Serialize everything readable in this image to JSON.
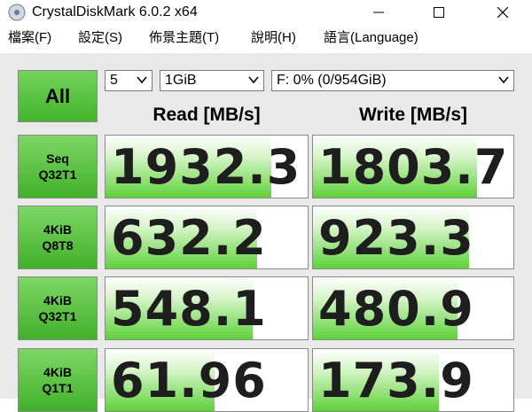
{
  "window": {
    "title": "CrystalDiskMark 6.0.2 x64"
  },
  "menu": [
    {
      "label": "檔案(F)"
    },
    {
      "label": "設定(S)"
    },
    {
      "label": "佈景主題(T)"
    },
    {
      "label": "說明(H)"
    },
    {
      "label": "語言(Language)"
    }
  ],
  "controls": {
    "all_label": "All",
    "test_count": "5",
    "test_size": "1GiB",
    "drive": "F: 0% (0/954GiB)"
  },
  "headers": {
    "read": "Read [MB/s]",
    "write": "Write [MB/s]"
  },
  "tests": [
    {
      "line1": "Seq",
      "line2": "Q32T1",
      "read": "1932.3",
      "write": "1803.7",
      "read_level": 0.82,
      "write_level": 0.82
    },
    {
      "line1": "4KiB",
      "line2": "Q8T8",
      "read": "632.2",
      "write": "923.3",
      "read_level": 0.75,
      "write_level": 0.78
    },
    {
      "line1": "4KiB",
      "line2": "Q32T1",
      "read": "548.1",
      "write": "480.9",
      "read_level": 0.73,
      "write_level": 0.72
    },
    {
      "line1": "4KiB",
      "line2": "Q1T1",
      "read": "61.96",
      "write": "173.9",
      "read_level": 0.54,
      "write_level": 0.63
    }
  ],
  "colors": {
    "accent": "#4cbb34",
    "panel": "#e9e9e9"
  }
}
